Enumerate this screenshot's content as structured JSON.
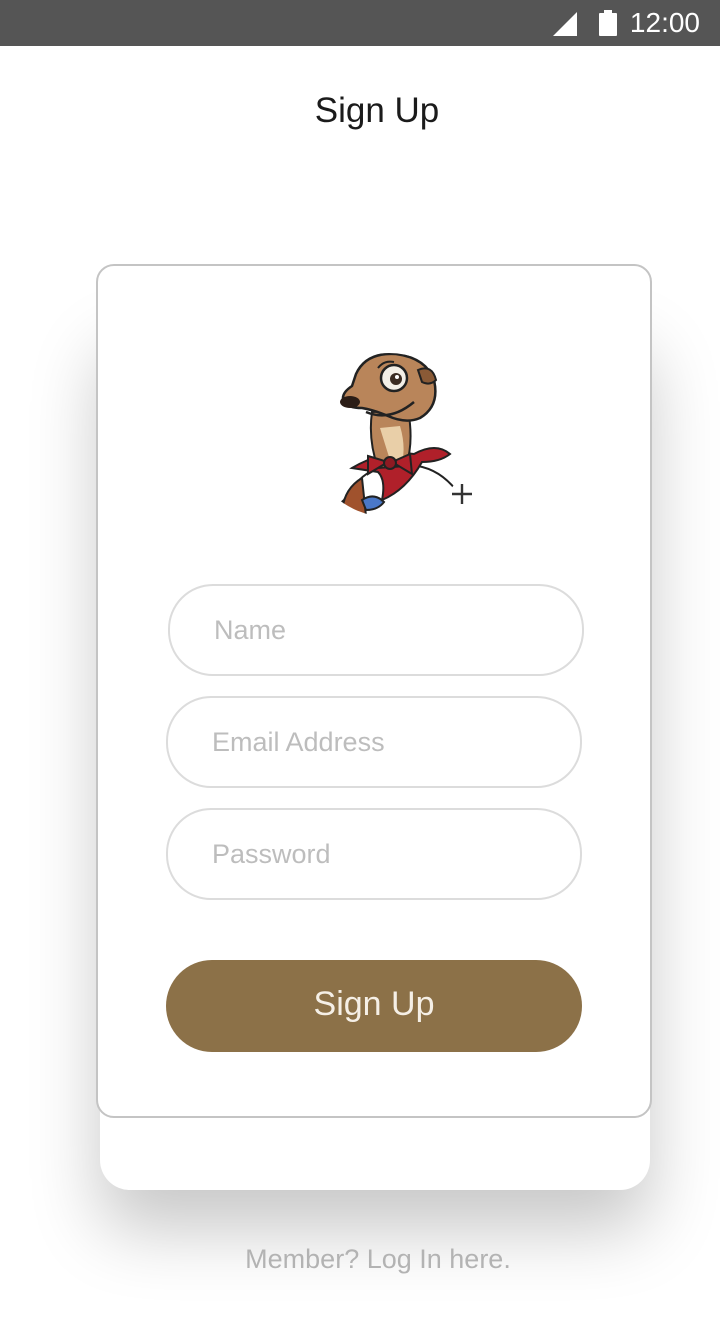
{
  "status_bar": {
    "time": "12:00",
    "signal_icon": "cell-signal-icon",
    "battery_icon": "battery-icon"
  },
  "header": {
    "title": "Sign Up"
  },
  "form": {
    "avatar_icon": "meerkat-avatar",
    "add_photo_icon": "plus-icon",
    "name_placeholder": "Name",
    "email_placeholder": "Email Address",
    "password_placeholder": "Password",
    "submit_label": "Sign Up"
  },
  "footer": {
    "login_link": "Member? Log In here."
  },
  "colors": {
    "status_bar": "#555555",
    "button": "#8c7148",
    "placeholder": "#bdbdbd",
    "footer_text": "#b3b3b3"
  }
}
